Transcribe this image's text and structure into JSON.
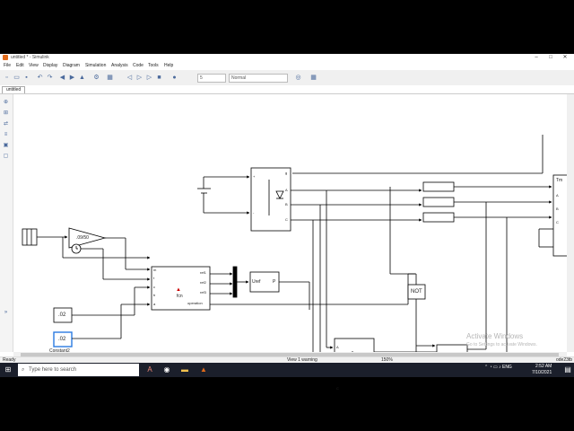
{
  "window": {
    "title": "untitled * - Simulink",
    "controls": [
      "–",
      "□",
      "✕"
    ]
  },
  "menu": [
    "File",
    "Edit",
    "View",
    "Display",
    "Diagram",
    "Simulation",
    "Analysis",
    "Code",
    "Tools",
    "Help"
  ],
  "toolbar": {
    "stop_time": "5",
    "mode": "Normal"
  },
  "tab": {
    "label": "untitled"
  },
  "blocks": {
    "gain": ".09/50",
    "const1": ".02",
    "const2": ".02",
    "const2_name": "Constant2",
    "fcn": {
      "label": "fcn",
      "inputs": [
        "m",
        "t",
        "c",
        "b",
        "a"
      ],
      "outputs": [
        "ref1",
        "ref2",
        "ref3",
        "operation"
      ]
    },
    "uref": {
      "in": "Uref",
      "out": "P"
    },
    "not": "NOT",
    "bridge_top": {
      "ports_out": [
        "g",
        "A",
        "B",
        "C"
      ],
      "ports_in": [
        "+",
        "-"
      ]
    },
    "bridge_bottom": {
      "ports": [
        "A",
        "B",
        "C"
      ]
    },
    "machine": {
      "label": "Tm",
      "ports": [
        "A",
        "B",
        "C"
      ]
    }
  },
  "status": {
    "left": "Ready",
    "middle": "View 1 warning",
    "zoom": "150%",
    "right": "ode23tb"
  },
  "watermark": {
    "title": "Activate Windows",
    "subtitle": "Go to Settings to activate Windows."
  },
  "taskbar": {
    "search_placeholder": "Type here to search",
    "time": "2:52 AM",
    "date": "7/10/2021"
  }
}
